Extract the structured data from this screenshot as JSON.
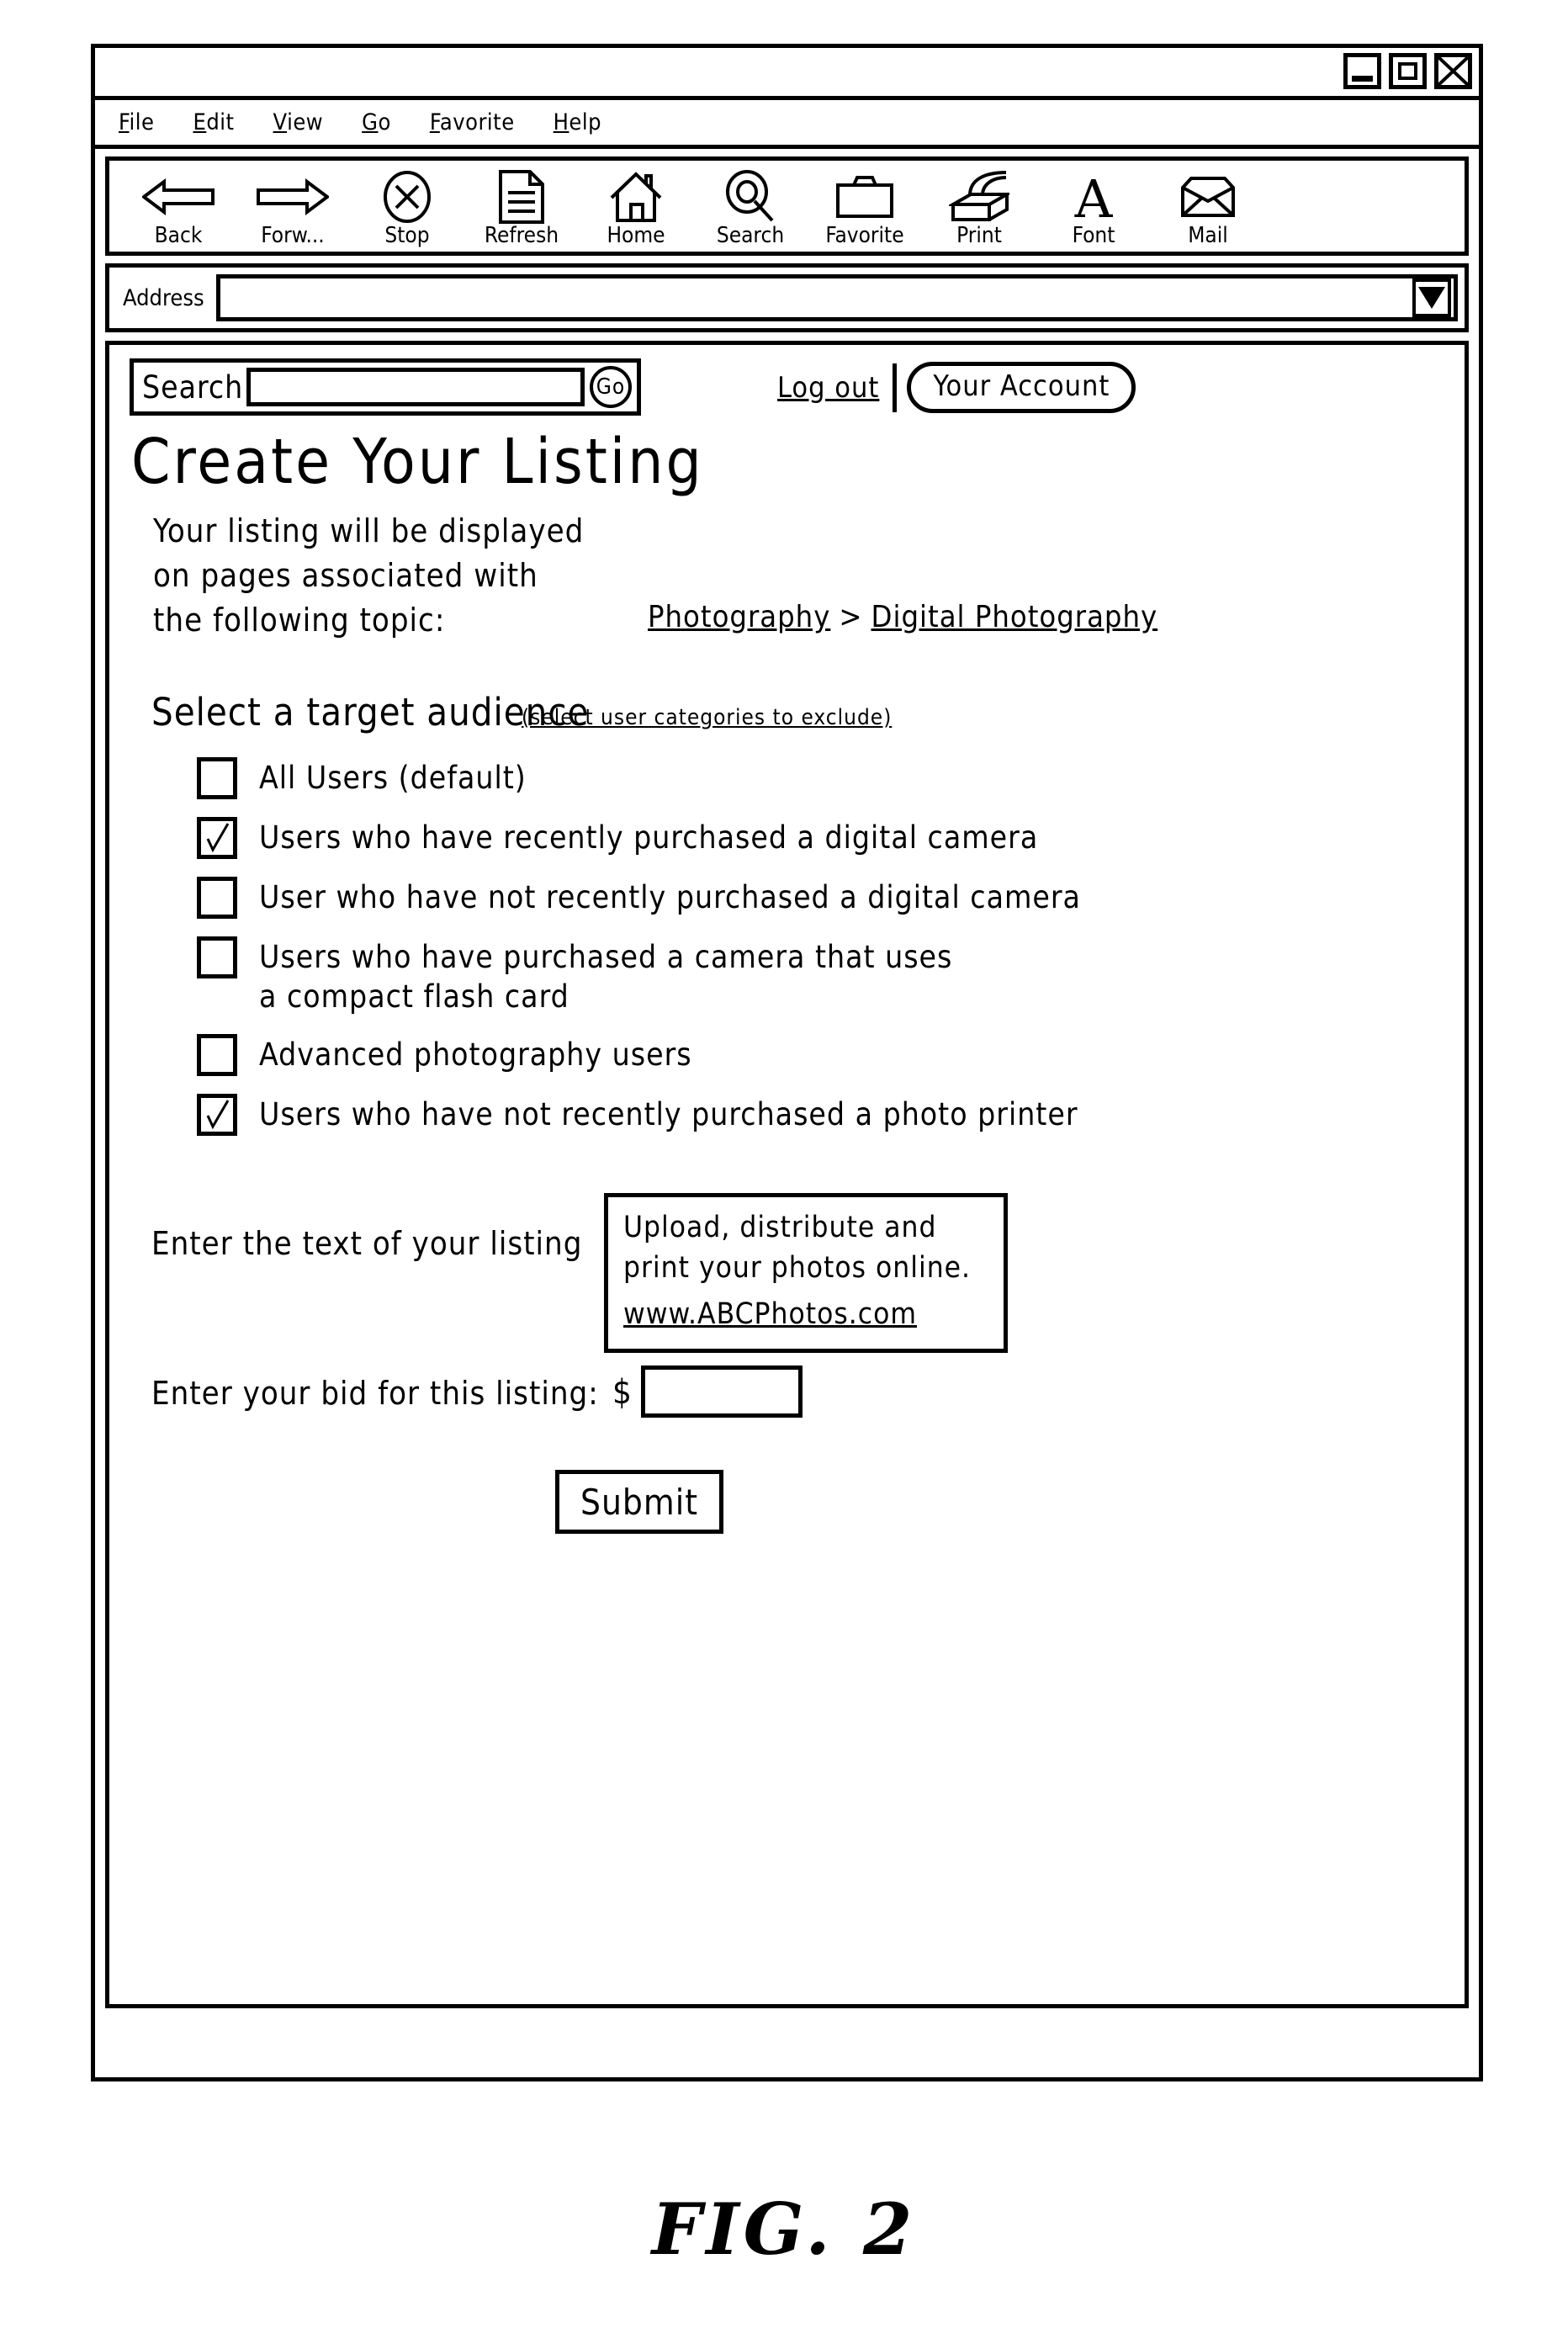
{
  "window": {
    "controls": [
      {
        "name": "minimize-button",
        "icon": "minimize-icon"
      },
      {
        "name": "maximize-button",
        "icon": "maximize-icon"
      },
      {
        "name": "close-button",
        "icon": "close-icon"
      }
    ]
  },
  "menu": {
    "items": [
      {
        "mnemonic": "F",
        "rest": "ile"
      },
      {
        "mnemonic": "E",
        "rest": "dit"
      },
      {
        "mnemonic": "V",
        "rest": "iew"
      },
      {
        "mnemonic": "G",
        "rest": "o"
      },
      {
        "mnemonic": "F",
        "rest": "avorite"
      },
      {
        "mnemonic": "H",
        "rest": "elp"
      }
    ]
  },
  "toolbar": {
    "items": [
      {
        "label": "Back",
        "icon": "arrow-left-icon"
      },
      {
        "label": "Forw...",
        "icon": "arrow-right-icon"
      },
      {
        "label": "Stop",
        "icon": "stop-circle-x-icon"
      },
      {
        "label": "Refresh",
        "icon": "document-icon"
      },
      {
        "label": "Home",
        "icon": "house-icon"
      },
      {
        "label": "Search",
        "icon": "magnifier-icon"
      },
      {
        "label": "Favorite",
        "icon": "folder-icon"
      },
      {
        "label": "Print",
        "icon": "printer-icon"
      },
      {
        "label": "Font",
        "icon": "letter-a-icon"
      },
      {
        "label": "Mail",
        "icon": "envelope-icon"
      }
    ]
  },
  "address": {
    "label": "Address",
    "value": "",
    "placeholder": "",
    "dropdown_icon": "chevron-down-icon"
  },
  "page": {
    "search": {
      "label": "Search",
      "value": "",
      "placeholder": "",
      "go_label": "Go"
    },
    "account": {
      "logout_label": "Log out",
      "account_label": "Your Account"
    },
    "title": "Create Your Listing",
    "intro": "Your listing will be displayed\non pages associated with\nthe following topic:",
    "breadcrumb": {
      "parent": "Photography",
      "separator": ">",
      "current": "Digital Photography"
    },
    "audience": {
      "title": "Select a target audience",
      "hint": "(select user categories to exclude)",
      "options": [
        {
          "label": "All Users (default)",
          "checked": false
        },
        {
          "label": "Users who have recently purchased a digital camera",
          "checked": true
        },
        {
          "label": "User who have not recently purchased a digital camera",
          "checked": false
        },
        {
          "label": "Users who have purchased a camera that uses\na compact flash card",
          "checked": false
        },
        {
          "label": "Advanced photography users",
          "checked": false
        },
        {
          "label": "Users who have not recently purchased a photo printer",
          "checked": true
        }
      ]
    },
    "listing": {
      "label": "Enter the text of your listing",
      "text": "Upload, distribute and\nprint your photos online.",
      "url": "www.ABCPhotos.com"
    },
    "bid": {
      "label": "Enter your bid for this listing:",
      "currency": "$",
      "value": "",
      "placeholder": ""
    },
    "submit_label": "Submit"
  },
  "figure": {
    "caption": "FIG.  2"
  }
}
